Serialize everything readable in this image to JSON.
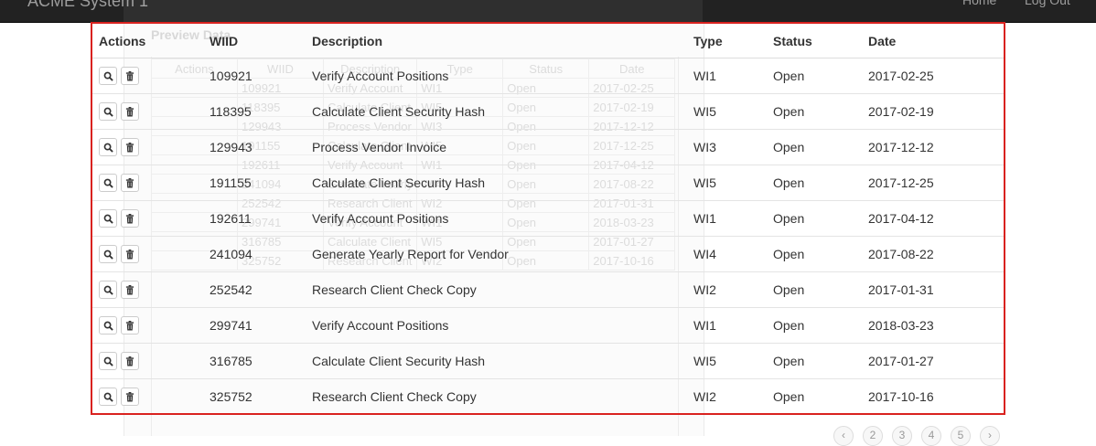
{
  "navbar": {
    "brand": "ACME System 1",
    "home": "Home",
    "logout": "Log Out"
  },
  "ghost": {
    "title": "Preview Data",
    "headers": [
      "Actions",
      "WIID",
      "Description",
      "Type",
      "Status",
      "Date"
    ],
    "rows": [
      [
        "",
        "109921",
        "Verify Account",
        "WI1",
        "Open",
        "2017-02-25"
      ],
      [
        "",
        "118395",
        "Calculate Client",
        "WI5",
        "Open",
        "2017-02-19"
      ],
      [
        "",
        "129943",
        "Process Vendor",
        "WI3",
        "Open",
        "2017-12-12"
      ],
      [
        "",
        "191155",
        "Calculate Client",
        "WI5",
        "Open",
        "2017-12-25"
      ],
      [
        "",
        "192611",
        "Verify Account",
        "WI1",
        "Open",
        "2017-04-12"
      ],
      [
        "",
        "241094",
        "Generate Yearly",
        "WI4",
        "Open",
        "2017-08-22"
      ],
      [
        "",
        "252542",
        "Research Client",
        "WI2",
        "Open",
        "2017-01-31"
      ],
      [
        "",
        "299741",
        "Verify Account",
        "WI1",
        "Open",
        "2018-03-23"
      ],
      [
        "",
        "316785",
        "Calculate Client",
        "WI5",
        "Open",
        "2017-01-27"
      ],
      [
        "",
        "325752",
        "Research Client",
        "WI2",
        "Open",
        "2017-10-16"
      ]
    ]
  },
  "table": {
    "headers": {
      "actions": "Actions",
      "wiid": "WIID",
      "description": "Description",
      "type": "Type",
      "status": "Status",
      "date": "Date"
    },
    "rows": [
      {
        "wiid": "109921",
        "description": "Verify Account Positions",
        "type": "WI1",
        "status": "Open",
        "date": "2017-02-25"
      },
      {
        "wiid": "118395",
        "description": "Calculate Client Security Hash",
        "type": "WI5",
        "status": "Open",
        "date": "2017-02-19"
      },
      {
        "wiid": "129943",
        "description": "Process Vendor Invoice",
        "type": "WI3",
        "status": "Open",
        "date": "2017-12-12"
      },
      {
        "wiid": "191155",
        "description": "Calculate Client Security Hash",
        "type": "WI5",
        "status": "Open",
        "date": "2017-12-25"
      },
      {
        "wiid": "192611",
        "description": "Verify Account Positions",
        "type": "WI1",
        "status": "Open",
        "date": "2017-04-12"
      },
      {
        "wiid": "241094",
        "description": "Generate Yearly Report for Vendor",
        "type": "WI4",
        "status": "Open",
        "date": "2017-08-22"
      },
      {
        "wiid": "252542",
        "description": "Research Client Check Copy",
        "type": "WI2",
        "status": "Open",
        "date": "2017-01-31"
      },
      {
        "wiid": "299741",
        "description": "Verify Account Positions",
        "type": "WI1",
        "status": "Open",
        "date": "2018-03-23"
      },
      {
        "wiid": "316785",
        "description": "Calculate Client Security Hash",
        "type": "WI5",
        "status": "Open",
        "date": "2017-01-27"
      },
      {
        "wiid": "325752",
        "description": "Research Client Check Copy",
        "type": "WI2",
        "status": "Open",
        "date": "2017-10-16"
      }
    ],
    "row_action_icons": [
      "search-icon",
      "trash-icon"
    ]
  },
  "pagination": {
    "pages": [
      "‹",
      "2",
      "3",
      "4",
      "5",
      "›"
    ]
  },
  "colors": {
    "navbar_bg": "#222222",
    "highlight_border": "#d9221f"
  }
}
